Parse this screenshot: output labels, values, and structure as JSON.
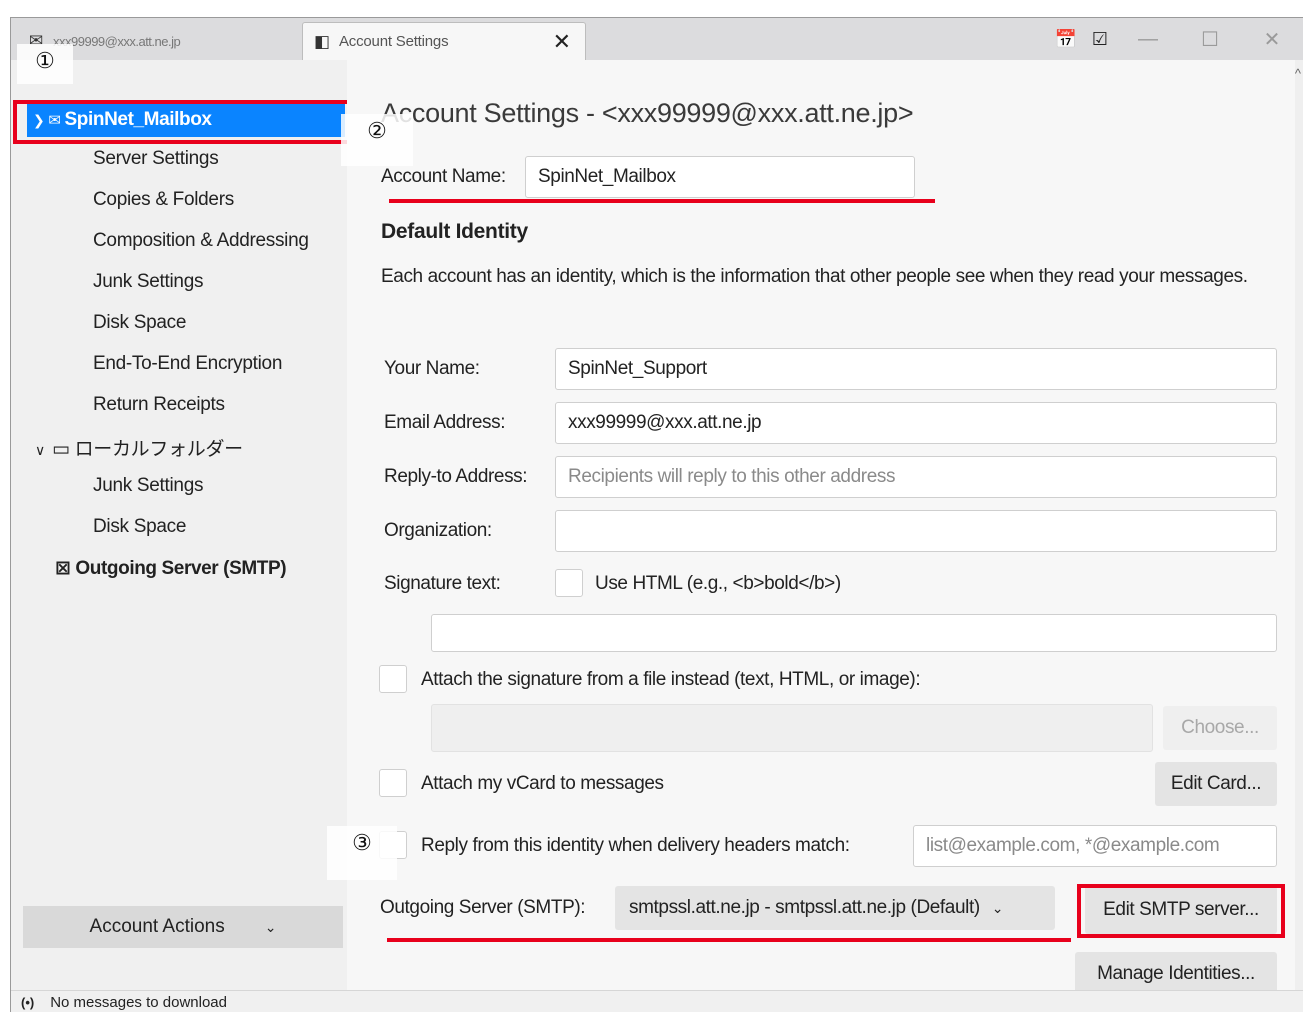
{
  "tabs": [
    {
      "label": "xxx99999@xxx.att.ne.jp",
      "icon": "mail-icon",
      "active": false
    },
    {
      "label": "Account Settings",
      "icon": "settings-tab-icon",
      "active": true,
      "close": "✕"
    }
  ],
  "window_controls": {
    "calendar": "calendar-icon",
    "tasks": "tasks-icon",
    "minimize": "—",
    "maximize": "☐",
    "close": "✕"
  },
  "markers": {
    "one": "①",
    "two": "②",
    "three": "③"
  },
  "sidebar": {
    "account": {
      "name": "SpinNet_Mailbox",
      "chevron": "v",
      "icon": "mail-icon"
    },
    "account_items": [
      "Server Settings",
      "Copies & Folders",
      "Composition & Addressing",
      "Junk Settings",
      "Disk Space",
      "End-To-End Encryption",
      "Return Receipts"
    ],
    "local_folder": {
      "name": "ローカルフォルダー",
      "chevron": "v",
      "icon": "folder-icon"
    },
    "local_items": [
      "Junk Settings",
      "Disk Space"
    ],
    "smtp": {
      "name": "Outgoing Server (SMTP)",
      "icon": "smtp-icon"
    },
    "account_actions": "Account Actions"
  },
  "main": {
    "title": "Account Settings - <xxx99999@xxx.att.ne.jp>",
    "account_name_label": "Account Name:",
    "account_name_value": "SpinNet_Mailbox",
    "default_identity": "Default Identity",
    "identity_desc": "Each account has an identity, which is the information that other people see when they read your messages.",
    "your_name_label": "Your Name:",
    "your_name_value": "SpinNet_Support",
    "email_label": "Email Address:",
    "email_value": "xxx99999@xxx.att.ne.jp",
    "reply_to_label": "Reply-to Address:",
    "reply_to_placeholder": "Recipients will reply to this other address",
    "organization_label": "Organization:",
    "organization_value": "",
    "signature_label": "Signature text:",
    "use_html_label": "Use HTML (e.g., <b>bold</b>)",
    "attach_signature_label": "Attach the signature from a file instead (text, HTML, or image):",
    "choose_button": "Choose...",
    "attach_vcard_label": "Attach my vCard to messages",
    "edit_card_button": "Edit Card...",
    "reply_from_label": "Reply from this identity when delivery headers match:",
    "reply_from_placeholder": "list@example.com, *@example.com",
    "outgoing_label": "Outgoing Server (SMTP):",
    "outgoing_value": "smtpssl.att.ne.jp - smtpssl.att.ne.jp (Default)",
    "edit_smtp_button": "Edit SMTP server...",
    "manage_identities_button": "Manage Identities..."
  },
  "status": {
    "text": "No messages to download",
    "icon": "(•)"
  },
  "colors": {
    "selection": "#0a84ff",
    "annotation_red": "#e8001c"
  }
}
